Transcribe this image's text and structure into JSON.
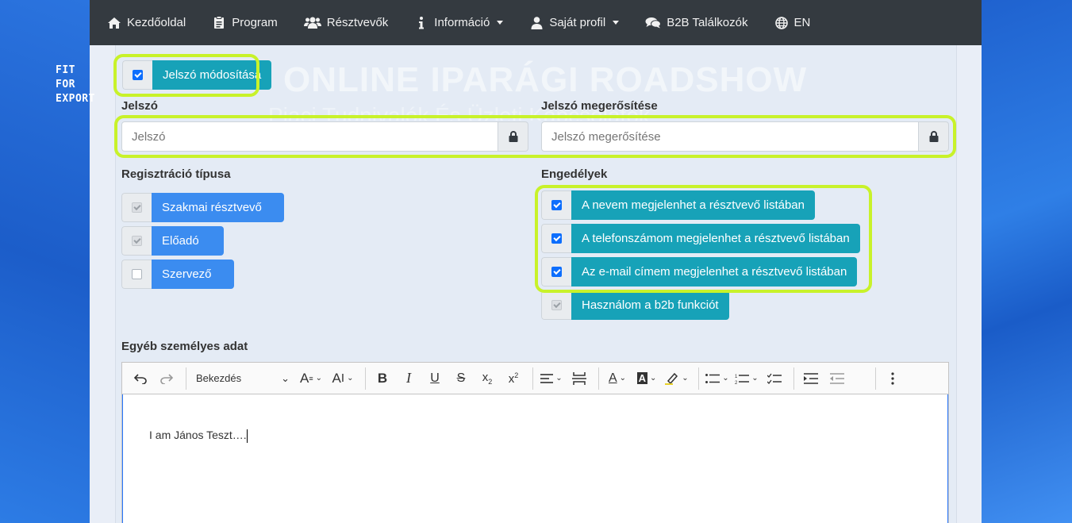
{
  "nav": {
    "home": "Kezdőoldal",
    "program": "Program",
    "participants": "Résztvevők",
    "info": "Információ",
    "profile": "Saját profil",
    "b2b": "B2B Találkozók",
    "lang": "EN"
  },
  "logo": {
    "line1": "FIT",
    "line2": "FOR",
    "line3": "EXPORT"
  },
  "banner": {
    "title": "ONLINE IPARÁGI ROADSHOW",
    "subtitle": "Piaci Tudnivalók És Üzleti Kapcsolatok"
  },
  "password_change": {
    "label": "Jelszó módosítása",
    "checked": true
  },
  "password": {
    "label": "Jelszó",
    "placeholder": "Jelszó"
  },
  "password_confirm": {
    "label": "Jelszó megerősítése",
    "placeholder": "Jelszó megerősítése"
  },
  "registration": {
    "label": "Regisztráció típusa",
    "options": [
      {
        "label": "Szakmai résztvevő",
        "checked": true,
        "disabled": true
      },
      {
        "label": "Előadó",
        "checked": true,
        "disabled": true
      },
      {
        "label": "Szervező",
        "checked": false,
        "disabled": false
      }
    ]
  },
  "permissions": {
    "label": "Engedélyek",
    "options": [
      {
        "label": "A nevem megjelenhet a résztvevő listában",
        "checked": true
      },
      {
        "label": "A telefonszámom megjelenhet a résztvevő listában",
        "checked": true
      },
      {
        "label": "Az e-mail címem megjelenhet a résztvevő listában",
        "checked": true
      },
      {
        "label": "Használom a b2b funkciót",
        "checked": true,
        "disabled": true
      }
    ]
  },
  "other": {
    "label": "Egyéb személyes adat",
    "paragraph_style": "Bekezdés",
    "content": "I am János Teszt…."
  },
  "colors": {
    "highlight": "#c8f22a",
    "teal": "#17a2b8",
    "blue": "#3b8cf0",
    "navbar": "#343a40"
  }
}
